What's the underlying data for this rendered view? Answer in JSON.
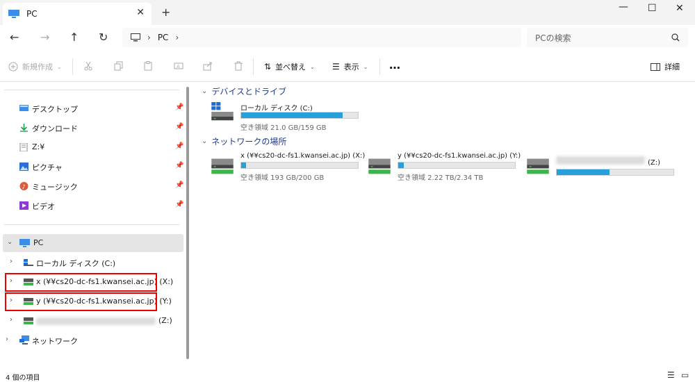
{
  "window": {
    "tab_title": "PC",
    "close_tab": "✕",
    "new_tab": "+",
    "minimize": "—",
    "maximize": "☐",
    "close": "✕"
  },
  "nav": {
    "back": "←",
    "forward": "→",
    "up": "↑",
    "refresh": "↻",
    "breadcrumb": [
      "PC"
    ],
    "sep": "›",
    "search_placeholder": "PCの検索"
  },
  "toolbar": {
    "new_label": "新規作成",
    "sort_label": "並べ替え",
    "view_label": "表示",
    "more": "…",
    "details_label": "詳細"
  },
  "sidebar": {
    "quick": [
      {
        "label": "デスクトップ",
        "icon": "desktop-icon",
        "color": "#3a8ee6"
      },
      {
        "label": "ダウンロード",
        "icon": "download-icon",
        "color": "#1e9e4a"
      },
      {
        "label": "Z:¥",
        "icon": "folder-icon",
        "color": "#888888"
      },
      {
        "label": "ピクチャ",
        "icon": "pictures-icon",
        "color": "#2b6fd6"
      },
      {
        "label": "ミュージック",
        "icon": "music-icon",
        "color": "#e05a3a"
      },
      {
        "label": "ビデオ",
        "icon": "videos-icon",
        "color": "#8a3ad6"
      }
    ],
    "pc_label": "PC",
    "tree": [
      {
        "label": "ローカル ディスク (C:)"
      },
      {
        "label": "x (¥¥cs20-dc-fs1.kwansei.ac.jp) (X:)"
      },
      {
        "label": "y (¥¥cs20-dc-fs1.kwansei.ac.jp) (Y:)"
      },
      {
        "label": "(Z:)"
      }
    ],
    "network_label": "ネットワーク"
  },
  "content": {
    "devices_header": "デバイスとドライブ",
    "network_header": "ネットワークの場所",
    "local": {
      "name": "ローカル ディスク (C:)",
      "free": "空き領域 21.0 GB/159 GB",
      "used_fraction": 0.87
    },
    "network": [
      {
        "name": "x (¥¥cs20-dc-fs1.kwansei.ac.jp) (X:)",
        "free": "空き領域 193 GB/200 GB",
        "used_fraction": 0.04
      },
      {
        "name": "y (¥¥cs20-dc-fs1.kwansei.ac.jp) (Y:)",
        "free": "空き領域 2.22 TB/2.34 TB",
        "used_fraction": 0.05
      },
      {
        "name": "(Z:)",
        "free": "",
        "used_fraction": 0.45
      }
    ]
  },
  "status": {
    "count": "4 個の項目"
  },
  "colors": {
    "accent": "#26a0da",
    "header": "#1f3a8a",
    "highlight": "#e00000"
  }
}
